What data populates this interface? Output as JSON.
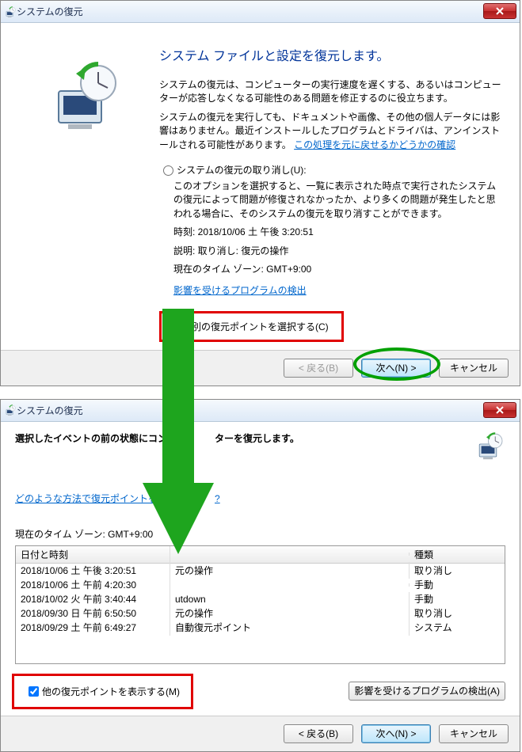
{
  "dlg1": {
    "title": "システムの復元",
    "heading": "システム ファイルと設定を復元します。",
    "para1": "システムの復元は、コンピューターの実行速度を遅くする、あるいはコンピューターが応答しなくなる可能性のある問題を修正するのに役立ちます。",
    "para2a": "システムの復元を実行しても、ドキュメントや画像、その他の個人データには影響はありません。最近インストールしたプログラムとドライバは、アンインストールされる可能性があります。",
    "para2_link": "この処理を元に戻せるかどうかの確認",
    "radio_undo": "システムの復元の取り消し(U):",
    "undo_desc": "このオプションを選択すると、一覧に表示された時点で実行されたシステムの復元によって問題が修復されなかったか、より多くの問題が発生したと思われる場合に、そのシステムの復元を取り消すことができます。",
    "time_label": "時刻: ",
    "time_value": "2018/10/06 土 午後 3:20:51",
    "desc_label": "説明: ",
    "desc_value": "取り消し: 復元の操作",
    "tz_label": "現在のタイム ゾーン: ",
    "tz_value": "GMT+9:00",
    "scan_link": "影響を受けるプログラムの検出",
    "radio_choose": "別の復元ポイントを選択する(C)",
    "btn_back": "< 戻る(B)",
    "btn_next": "次へ(N) >",
    "btn_cancel": "キャンセル"
  },
  "dlg2": {
    "title": "システムの復元",
    "heading_a": "選択したイベントの前の状態にコン",
    "heading_b": "ターを復元します。",
    "howto_link_a": "どのような方法で復元ポイントを選択",
    "howto_link_b": "?",
    "tz_line": "現在のタイム ゾーン: GMT+9:00",
    "col_date": "日付と時刻",
    "col_desc": "",
    "col_type": "種類",
    "rows": [
      {
        "date": "2018/10/06 土 午後 3:20:51",
        "desc": "元の操作",
        "type": "取り消し"
      },
      {
        "date": "2018/10/06 土 午前 4:20:30",
        "desc": "",
        "type": "手動"
      },
      {
        "date": "2018/10/02 火 午前 3:40:44",
        "desc": "utdown",
        "type": "手動"
      },
      {
        "date": "2018/09/30 日 午前 6:50:50",
        "desc": "元の操作",
        "type": "取り消し"
      },
      {
        "date": "2018/09/29 土 午前 6:49:27",
        "desc": "自動復元ポイント",
        "type": "システム"
      }
    ],
    "checkbox": "他の復元ポイントを表示する(M)",
    "scan_btn": "影響を受けるプログラムの検出(A)",
    "btn_back": "< 戻る(B)",
    "btn_next": "次へ(N) >",
    "btn_cancel": "キャンセル"
  }
}
